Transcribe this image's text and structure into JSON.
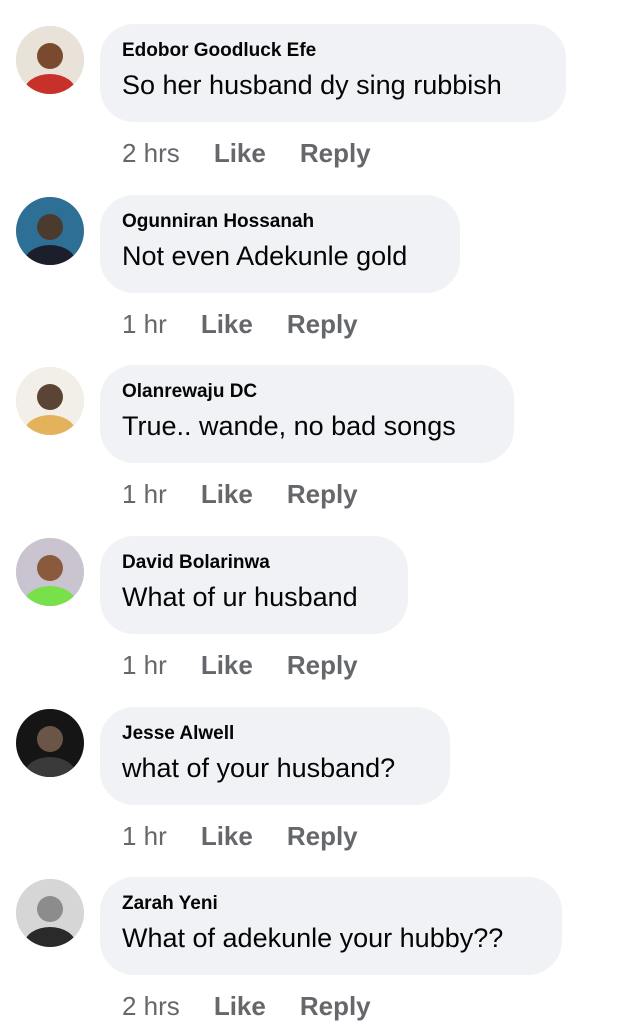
{
  "comments": [
    {
      "author": "Edobor Goodluck Efe",
      "text": "So her husband dy sing rubbish",
      "time": "2 hrs",
      "like_label": "Like",
      "reply_label": "Reply",
      "avatar_colors": [
        "#e8e2d8",
        "#c8302a",
        "#7a4a2e"
      ]
    },
    {
      "author": "Ogunniran Hossanah",
      "text": "Not even Adekunle gold",
      "time": "1 hr",
      "like_label": "Like",
      "reply_label": "Reply",
      "avatar_colors": [
        "#2e6f96",
        "#1c1f2b",
        "#4b3b2f"
      ]
    },
    {
      "author": "Olanrewaju DC",
      "text": "True.. wande, no bad songs",
      "time": "1 hr",
      "like_label": "Like",
      "reply_label": "Reply",
      "avatar_colors": [
        "#f2efe8",
        "#e3b25a",
        "#5b4434"
      ]
    },
    {
      "author": "David Bolarinwa",
      "text": "What of ur husband",
      "time": "1 hr",
      "like_label": "Like",
      "reply_label": "Reply",
      "avatar_colors": [
        "#c9c4cf",
        "#78e04a",
        "#8a5a3c"
      ]
    },
    {
      "author": "Jesse Alwell",
      "text": "what of your husband?",
      "time": "1 hr",
      "like_label": "Like",
      "reply_label": "Reply",
      "avatar_colors": [
        "#151515",
        "#3a3a3a",
        "#6b5546"
      ]
    },
    {
      "author": "Zarah Yeni",
      "text": "What of adekunle your hubby??",
      "time": "2 hrs",
      "like_label": "Like",
      "reply_label": "Reply",
      "avatar_colors": [
        "#d6d6d6",
        "#2a2a2a",
        "#8c8c8c"
      ]
    }
  ]
}
